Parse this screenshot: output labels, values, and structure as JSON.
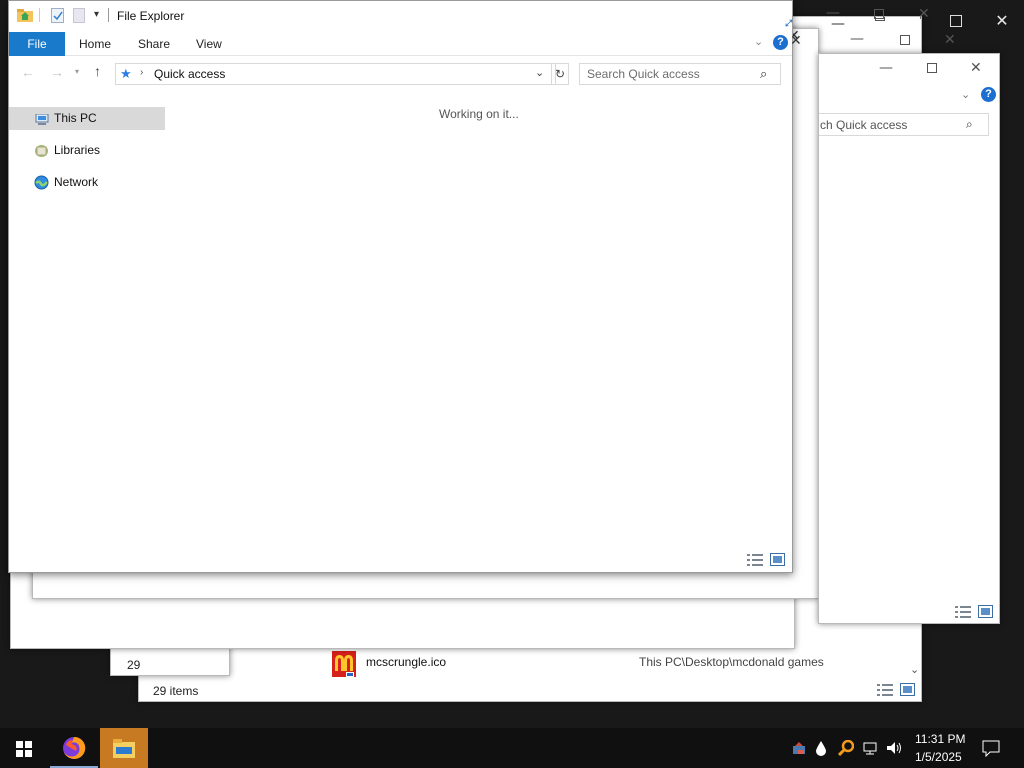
{
  "explorer": {
    "title": "File Explorer",
    "tabs": {
      "file": "File",
      "home": "Home",
      "share": "Share",
      "view": "View"
    },
    "address": {
      "location": "Quick access"
    },
    "search": {
      "placeholder": "Search Quick access"
    },
    "status": "Working on it...",
    "nav": [
      {
        "label": "This PC",
        "icon": "computer-icon",
        "selected": true
      },
      {
        "label": "Libraries",
        "icon": "libraries-icon",
        "selected": false
      },
      {
        "label": "Network",
        "icon": "network-icon",
        "selected": false
      }
    ]
  },
  "background_windows": {
    "search_fragment": "ch Quick access",
    "file_row": {
      "name": "mcscrungle.ico",
      "path": "This PC\\Desktop\\mcdonald games"
    },
    "items_count": "29 items",
    "items_count_partial": "29"
  },
  "taskbar": {
    "clock": {
      "time": "11:31 PM",
      "date": "1/5/2025"
    },
    "pinned": [
      "windows-start-icon",
      "firefox-icon",
      "file-explorer-icon"
    ]
  },
  "colors": {
    "accent": "#1979ca",
    "file_tab_bg": "#1979ca",
    "help_icon": "#1a6fd0",
    "taskbar_bg": "#101010",
    "desktop_bg": "#191919",
    "explorer_taskbar_active": "#c87a23"
  }
}
